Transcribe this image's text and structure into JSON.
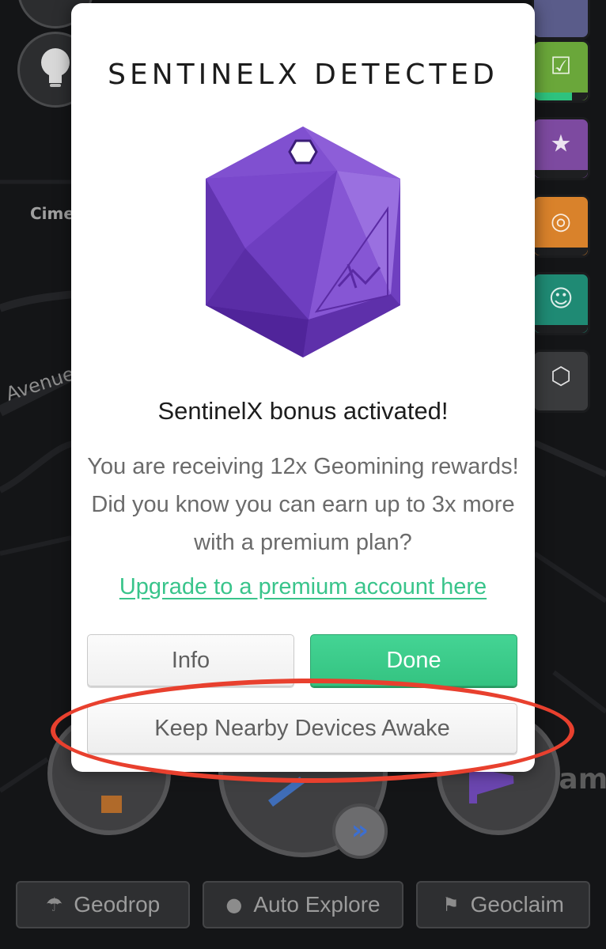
{
  "map": {
    "labels": {
      "avenue": "Avenue",
      "cimet": "Cimet",
      "camp": "Cam",
      "top_right": "..."
    }
  },
  "modal": {
    "title": "SENTINELX DETECTED",
    "heading": "SentinelX bonus activated!",
    "body": "You are receiving 12x Geomining rewards! Did you know you can earn up to 3x more with a premium plan?",
    "upgrade_link": "Upgrade to a premium account here",
    "buttons": {
      "info": "Info",
      "done": "Done",
      "keep_awake": "Keep Nearby Devices Awake"
    }
  },
  "action_bar": {
    "geodrop": "Geodrop",
    "auto_explore": "Auto Explore",
    "geoclaim": "Geoclaim"
  },
  "side_tiles": {
    "progress": [
      0.7,
      0.0,
      0.0,
      0.0,
      0.0
    ]
  },
  "colors": {
    "accent_green": "#39c48b",
    "done_button": "#3ccb8a",
    "annotation_red": "#e8402e",
    "gem_purple": "#7a45c4"
  },
  "icons": [
    "lightbulb-icon",
    "clipboard-check-icon",
    "calendar-star-icon",
    "coins-icon",
    "robot-icon",
    "d20-icon",
    "parachute-icon",
    "flag-icon",
    "fast-forward-icon"
  ]
}
